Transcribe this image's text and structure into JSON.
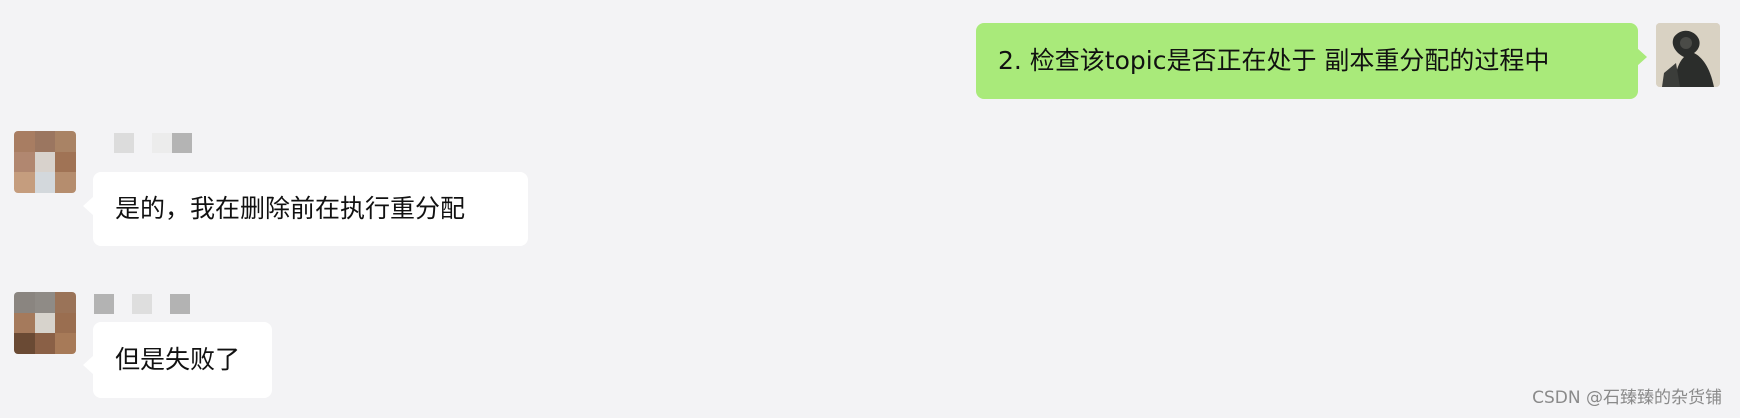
{
  "chat": {
    "messages": [
      {
        "sender": "self",
        "text": "2. 检查该topic是否正在处于 副本重分配的过程中"
      },
      {
        "sender": "other",
        "text": "是的，我在删除前在执行重分配"
      },
      {
        "sender": "other",
        "text": "但是失败了"
      }
    ]
  },
  "watermark": "CSDN @石臻臻的杂货铺",
  "colors": {
    "background": "#f3f3f5",
    "self_bubble": "#a9ea7a",
    "other_bubble": "#ffffff"
  }
}
